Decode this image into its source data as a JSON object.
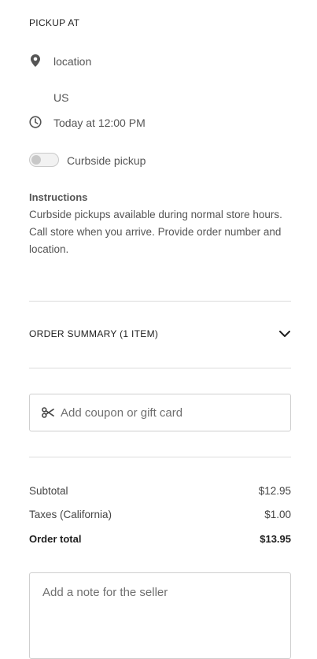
{
  "pickup": {
    "title": "PICKUP AT",
    "location_label": "location",
    "country": "US",
    "time": "Today at 12:00 PM",
    "curbside_label": "Curbside pickup",
    "curbside_enabled": false
  },
  "instructions": {
    "title": "Instructions",
    "body": "Curbside pickups available during normal store hours.\nCall store when you arrive. Provide order number and location."
  },
  "order_summary": {
    "label": "ORDER SUMMARY (1 ITEM)",
    "expand_icon": "chevron-down-icon"
  },
  "coupon": {
    "placeholder": "Add coupon or gift card",
    "icon": "scissors-icon"
  },
  "totals": {
    "subtotal_label": "Subtotal",
    "subtotal_value": "$12.95",
    "tax_label": "Taxes (California)",
    "tax_value": "$1.00",
    "total_label": "Order total",
    "total_value": "$13.95"
  },
  "note": {
    "placeholder": "Add a note for the seller"
  },
  "colors": {
    "text": "#373737",
    "muted": "#555555",
    "border": "#cfcfcf",
    "divider": "#dcdcdc"
  }
}
